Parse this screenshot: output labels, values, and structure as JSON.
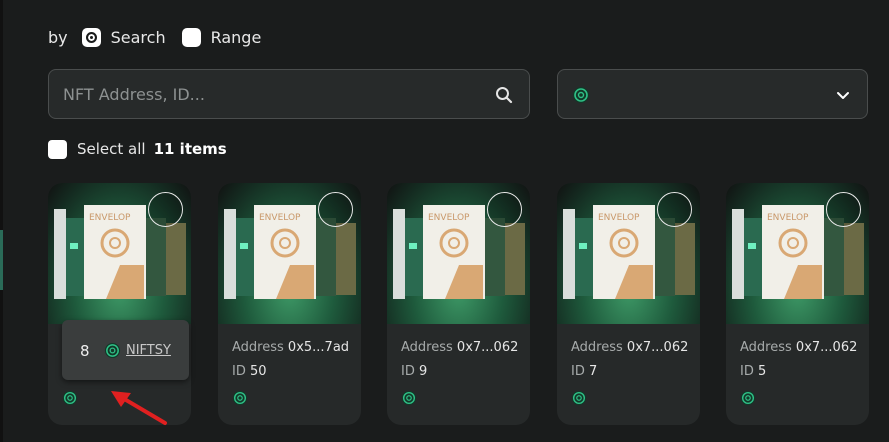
{
  "filter": {
    "by_label": "by",
    "options": [
      {
        "label": "Search",
        "selected": true
      },
      {
        "label": "Range",
        "selected": false
      }
    ]
  },
  "search": {
    "placeholder": "NFT Address, ID...",
    "value": ""
  },
  "chain_select": {
    "selected": "",
    "icon": "chain-icon"
  },
  "select_all": {
    "label": "Select all",
    "count": "11 items"
  },
  "cards": [
    {
      "address_label": "",
      "address": "",
      "id_label": "",
      "id": ""
    },
    {
      "address_label": "Address",
      "address": "0x5...7ad",
      "id_label": "ID",
      "id": "50"
    },
    {
      "address_label": "Address",
      "address": "0x7...062",
      "id_label": "ID",
      "id": "9"
    },
    {
      "address_label": "Address",
      "address": "0x7...062",
      "id_label": "ID",
      "id": "7"
    },
    {
      "address_label": "Address",
      "address": "0x7...062",
      "id_label": "ID",
      "id": "5"
    }
  ],
  "tooltip": {
    "number": "8",
    "link": "NIFTSY"
  },
  "colors": {
    "accent": "#2fbf86",
    "background": "#1a1c1c",
    "card": "#262929",
    "arrow": "#e02020"
  }
}
